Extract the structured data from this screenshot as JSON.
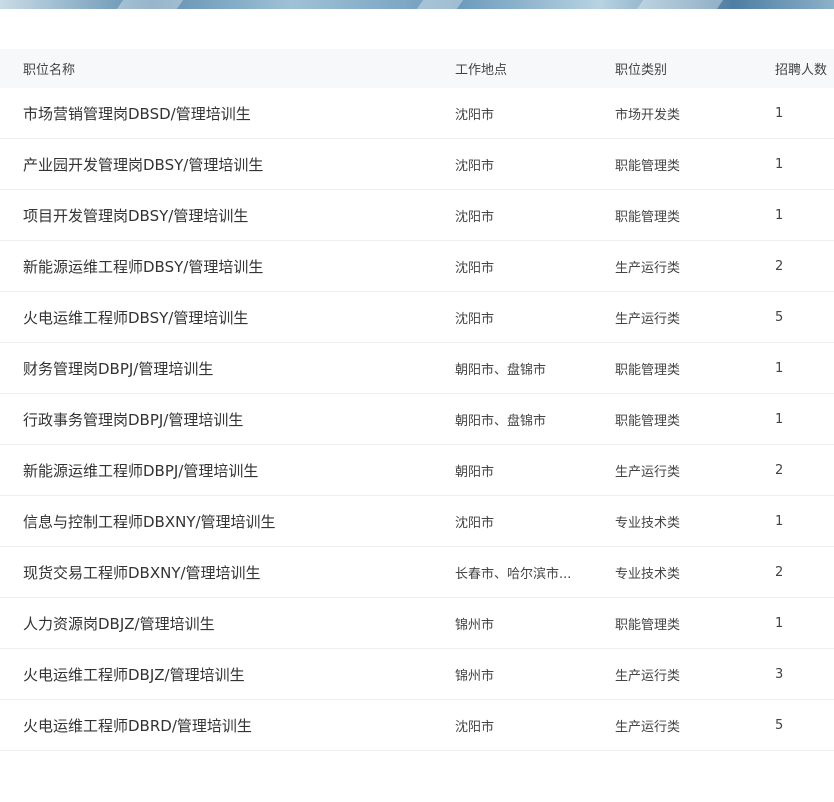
{
  "table": {
    "headers": {
      "position": "职位名称",
      "location": "工作地点",
      "category": "职位类别",
      "headcount": "招聘人数"
    },
    "rows": [
      {
        "position": "市场营销管理岗DBSD/管理培训生",
        "location": "沈阳市",
        "category": "市场开发类",
        "headcount": "1"
      },
      {
        "position": "产业园开发管理岗DBSY/管理培训生",
        "location": "沈阳市",
        "category": "职能管理类",
        "headcount": "1"
      },
      {
        "position": "项目开发管理岗DBSY/管理培训生",
        "location": "沈阳市",
        "category": "职能管理类",
        "headcount": "1"
      },
      {
        "position": "新能源运维工程师DBSY/管理培训生",
        "location": "沈阳市",
        "category": "生产运行类",
        "headcount": "2"
      },
      {
        "position": "火电运维工程师DBSY/管理培训生",
        "location": "沈阳市",
        "category": "生产运行类",
        "headcount": "5"
      },
      {
        "position": "财务管理岗DBPJ/管理培训生",
        "location": "朝阳市、盘锦市",
        "category": "职能管理类",
        "headcount": "1"
      },
      {
        "position": "行政事务管理岗DBPJ/管理培训生",
        "location": "朝阳市、盘锦市",
        "category": "职能管理类",
        "headcount": "1"
      },
      {
        "position": "新能源运维工程师DBPJ/管理培训生",
        "location": "朝阳市",
        "category": "生产运行类",
        "headcount": "2"
      },
      {
        "position": "信息与控制工程师DBXNY/管理培训生",
        "location": "沈阳市",
        "category": "专业技术类",
        "headcount": "1"
      },
      {
        "position": "现货交易工程师DBXNY/管理培训生",
        "location": "长春市、哈尔滨市...",
        "category": "专业技术类",
        "headcount": "2"
      },
      {
        "position": "人力资源岗DBJZ/管理培训生",
        "location": "锦州市",
        "category": "职能管理类",
        "headcount": "1"
      },
      {
        "position": "火电运维工程师DBJZ/管理培训生",
        "location": "锦州市",
        "category": "生产运行类",
        "headcount": "3"
      },
      {
        "position": "火电运维工程师DBRD/管理培训生",
        "location": "沈阳市",
        "category": "生产运行类",
        "headcount": "5"
      }
    ]
  }
}
